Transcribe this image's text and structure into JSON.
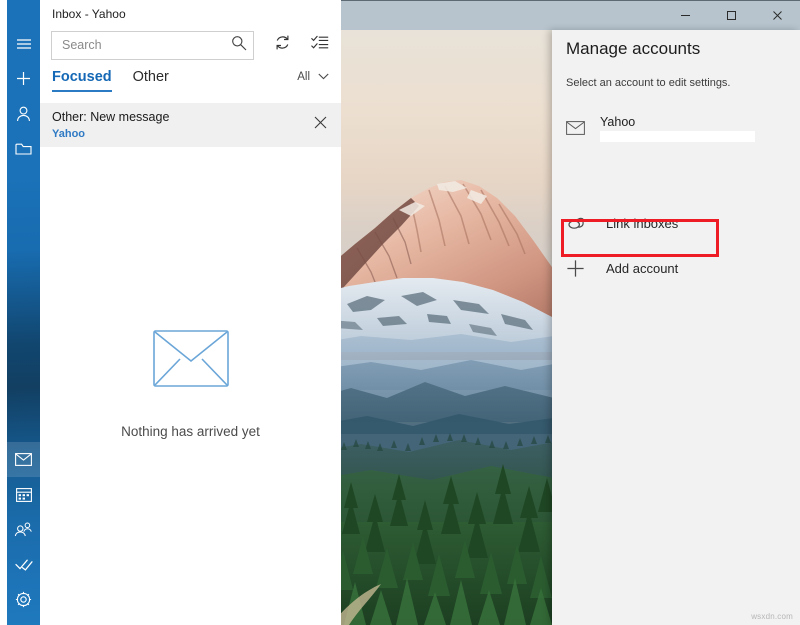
{
  "window": {
    "app_title": "Inbox - Yahoo",
    "controls": {
      "minimize": "minimize-icon",
      "maximize": "maximize-icon",
      "close": "close-icon"
    },
    "titlebar_color": "#b7c4ce"
  },
  "rail": {
    "accent_color": "#1b72b8",
    "top_items": [
      {
        "icon": "hamburger-icon",
        "label": "Navigation"
      },
      {
        "icon": "plus-icon",
        "label": "New mail"
      },
      {
        "icon": "person-icon",
        "label": "Accounts"
      },
      {
        "icon": "folder-icon",
        "label": "Folders"
      }
    ],
    "bottom_items": [
      {
        "icon": "mail-icon",
        "label": "Mail",
        "selected": true
      },
      {
        "icon": "calendar-icon",
        "label": "Calendar",
        "selected": false
      },
      {
        "icon": "people-icon",
        "label": "People",
        "selected": false
      },
      {
        "icon": "todo-icon",
        "label": "To Do",
        "selected": false
      },
      {
        "icon": "gear-icon",
        "label": "Settings",
        "selected": false
      }
    ]
  },
  "mail_pane": {
    "search": {
      "placeholder": "Search",
      "value": "",
      "icon": "search-icon"
    },
    "toolbar": {
      "sync": {
        "icon": "sync-icon",
        "label": "Sync this view"
      },
      "select": {
        "icon": "selection-mode-icon",
        "label": "Enter selection mode"
      }
    },
    "pivots": [
      {
        "label": "Focused",
        "active": true
      },
      {
        "label": "Other",
        "active": false
      }
    ],
    "filter": {
      "label": "All",
      "icon": "chevron-down-icon"
    },
    "notification": {
      "title": "Other: New message",
      "account": "Yahoo",
      "close_icon": "close-icon"
    },
    "empty_state": {
      "icon": "envelope-illustration",
      "caption": "Nothing has arrived yet"
    }
  },
  "flyout": {
    "title": "Manage accounts",
    "subtitle": "Select an account to edit settings.",
    "account": {
      "icon": "mail-envelope-icon",
      "name": "Yahoo",
      "address_redacted": ""
    },
    "items": [
      {
        "icon": "link-inboxes-icon",
        "label": "Link inboxes",
        "highlighted": false
      },
      {
        "icon": "plus-icon",
        "label": "Add account",
        "highlighted": true
      }
    ],
    "highlight_color": "#ee1c25",
    "background_color": "#f2f2f2"
  },
  "watermark": {
    "text": "wsxdn.com"
  }
}
